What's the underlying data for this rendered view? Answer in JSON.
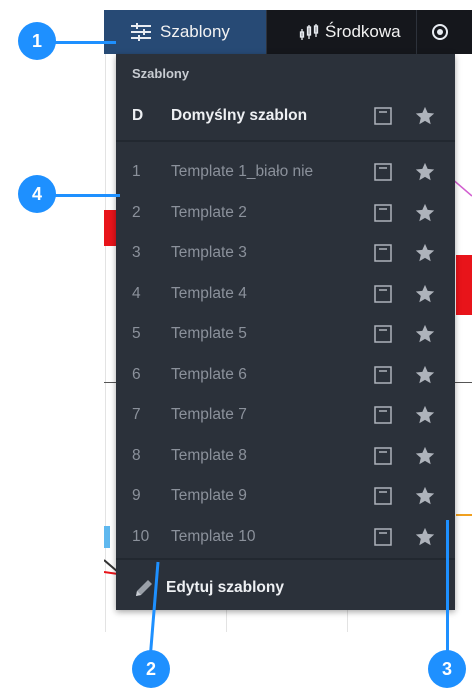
{
  "toolbar": {
    "templates_label": "Szablony",
    "middle_label": "Środkowa"
  },
  "dropdown": {
    "section_title": "Szablony",
    "default_template": {
      "key": "D",
      "label": "Domyślny szablon"
    },
    "templates": [
      {
        "number": "1",
        "label": "Template 1_biało nie"
      },
      {
        "number": "2",
        "label": "Template 2"
      },
      {
        "number": "3",
        "label": "Template 3"
      },
      {
        "number": "4",
        "label": "Template 4"
      },
      {
        "number": "5",
        "label": "Template 5"
      },
      {
        "number": "6",
        "label": "Template 6"
      },
      {
        "number": "7",
        "label": "Template 7"
      },
      {
        "number": "8",
        "label": "Template 8"
      },
      {
        "number": "9",
        "label": "Template 9"
      },
      {
        "number": "10",
        "label": "Template 10"
      }
    ],
    "edit_label": "Edytuj szablony"
  },
  "callouts": [
    "1",
    "2",
    "3",
    "4"
  ],
  "colors": {
    "accent": "#1e90ff",
    "toolbar_bg": "#15171c",
    "active_tab_bg": "#274a75",
    "dropdown_bg": "#2b313a",
    "candle_red": "#e8141a"
  },
  "icons": {
    "templates": "sliders-icon",
    "middle": "candlestick-icon",
    "save": "save-icon",
    "favorite": "star-icon",
    "edit": "pencil-icon"
  }
}
